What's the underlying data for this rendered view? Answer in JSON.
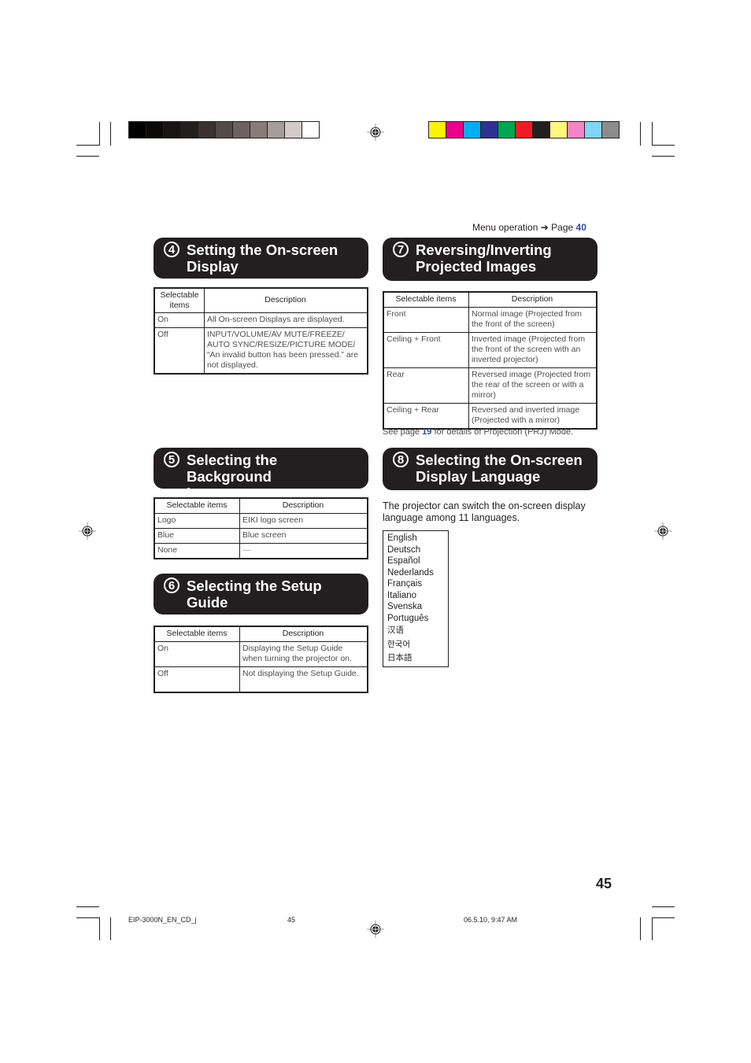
{
  "color_bars": {
    "grayscale": [
      "#000000",
      "#0c0a09",
      "#171413",
      "#231f1e",
      "#3a3230",
      "#544a47",
      "#6d625f",
      "#877b78",
      "#a69c99",
      "#d3cac9",
      "#ffffff"
    ],
    "process": [
      "#fff200",
      "#ec008c",
      "#00aeef",
      "#2e3192",
      "#00a651",
      "#ed1c24",
      "#231f20",
      "#fff77f",
      "#f584c6",
      "#7fd6f7",
      "#8c8c8c"
    ]
  },
  "header": {
    "menu_ref_label": "Menu operation",
    "arrow": "➔",
    "page_label": "Page",
    "page_num": "40"
  },
  "sections": {
    "s4": {
      "number": "4",
      "title_line1": "Setting the On-screen",
      "title_line2": "Display",
      "col1": "Selectable items",
      "col2": "Description",
      "rows": [
        {
          "item": "On",
          "desc": "All On-screen Displays are displayed."
        },
        {
          "item": "Off",
          "desc": "INPUT/VOLUME/AV MUTE/FREEZE/ AUTO SYNC/RESIZE/PICTURE MODE/ “An invalid button has been pressed.” are not displayed."
        }
      ]
    },
    "s5": {
      "number": "5",
      "title_line1": "Selecting the Background",
      "title_line2": "Image",
      "col1": "Selectable items",
      "col2": "Description",
      "rows": [
        {
          "item": "Logo",
          "desc": "EIKI logo screen"
        },
        {
          "item": "Blue",
          "desc": "Blue screen"
        },
        {
          "item": "None",
          "desc": "—"
        }
      ]
    },
    "s6": {
      "number": "6",
      "title_line1": "Selecting the Setup",
      "title_line2": "Guide",
      "col1": "Selectable items",
      "col2": "Description",
      "rows": [
        {
          "item": "On",
          "desc": "Displaying the Setup Guide when turning the projector on."
        },
        {
          "item": "Off",
          "desc": "Not displaying the Setup Guide."
        }
      ]
    },
    "s7": {
      "number": "7",
      "title_line1": "Reversing/Inverting",
      "title_line2": "Projected Images",
      "col1": "Selectable items",
      "col2": "Description",
      "rows": [
        {
          "item": "Front",
          "desc": "Normal image (Projected from the front of the screen)"
        },
        {
          "item": "Ceiling + Front",
          "desc": "Inverted image (Projected from the front of the screen with an inverted projector)"
        },
        {
          "item": "Rear",
          "desc": "Reversed image (Projected from the rear of the screen or with a mirror)"
        },
        {
          "item": "Ceiling + Rear",
          "desc": "Reversed and inverted image (Projected with a mirror)"
        }
      ],
      "note_prefix": "See page",
      "note_page": "19",
      "note_suffix": "for details of Projection (PRJ) Mode."
    },
    "s8": {
      "number": "8",
      "title_line1": "Selecting the On-screen",
      "title_line2": "Display Language",
      "intro": "The projector can switch the on-screen display language among 11 languages.",
      "languages": [
        "English",
        "Deutsch",
        "Español",
        "Nederlands",
        "Français",
        "Italiano",
        "Svenska",
        "Português",
        "汉语",
        "한국어",
        "日本語"
      ]
    }
  },
  "page_number": "45",
  "footer": {
    "file": "EIP-3000N_EN_CD_j",
    "page": "45",
    "timestamp": "06.5.10, 9:47 AM"
  }
}
